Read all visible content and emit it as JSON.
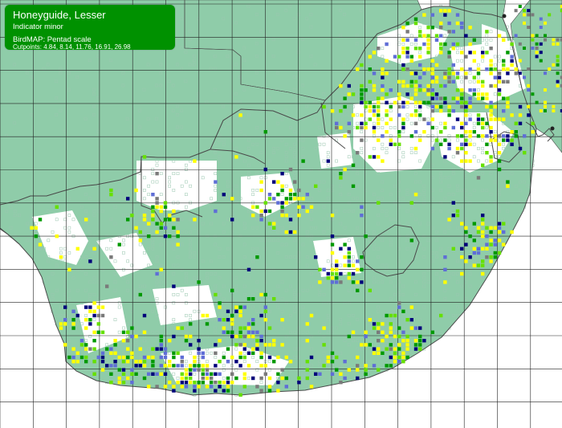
{
  "legend": {
    "title": "Honeyguide, Lesser",
    "latin": "Indicator minor",
    "scale": "BirdMAP: Pentad scale",
    "cutpoints": "Cutpoints: 4.84, 8.14, 11.76, 16.91, 26.98"
  },
  "colors": {
    "ocean": "#ffffff",
    "land_unsurveyed": "#8fcca9",
    "land_surveyed": "#ffffff",
    "grid_line": "#222222",
    "border": "#4a4a4a",
    "cell_open": "#9ac7b0",
    "class_1": "#ffff00",
    "class_2": "#66e000",
    "class_3": "#009900",
    "class_4": "#5f6ed6",
    "class_5": "#00007a",
    "class_zero": "#7a7a7a",
    "legend_bg": "#009100",
    "legend_text": "#ffffff"
  },
  "map": {
    "projection": "grid of degree squares",
    "region": "Southern Africa",
    "layers": [
      "land",
      "country borders",
      "degree grid",
      "pentad cells"
    ]
  }
}
